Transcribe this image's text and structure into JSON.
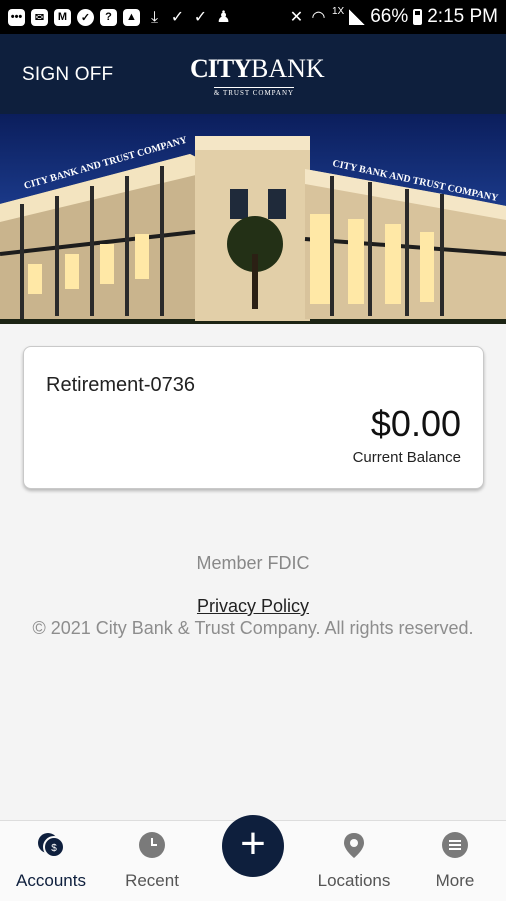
{
  "status_bar": {
    "signal_label": "1X",
    "battery": "66%",
    "time": "2:15 PM",
    "icons": [
      "chat-icon",
      "message-icon",
      "gmail-icon",
      "check-icon",
      "help-icon",
      "image-icon",
      "download-icon",
      "check-mark-icon",
      "check-mark-icon",
      "person-icon",
      "mute-icon",
      "wifi-icon",
      "signal-icon",
      "battery-icon"
    ]
  },
  "header": {
    "sign_off": "SIGN OFF",
    "logo_main_bold": "CITY",
    "logo_main_rest": "BANK",
    "logo_sub": "& TRUST COMPANY"
  },
  "hero": {
    "building_sign": "CITY BANK AND TRUST COMPANY"
  },
  "account": {
    "name": "Retirement-0736",
    "balance": "$0.00",
    "balance_label": "Current Balance"
  },
  "footer": {
    "fdic": "Member FDIC",
    "privacy": "Privacy Policy",
    "copyright": "© 2021 City Bank & Trust Company. All rights reserved."
  },
  "nav": {
    "accounts": "Accounts",
    "recent": "Recent",
    "add": "+",
    "locations": "Locations",
    "more": "More"
  },
  "colors": {
    "brand_navy": "#0e1f3d",
    "background": "#f4f4f4"
  }
}
